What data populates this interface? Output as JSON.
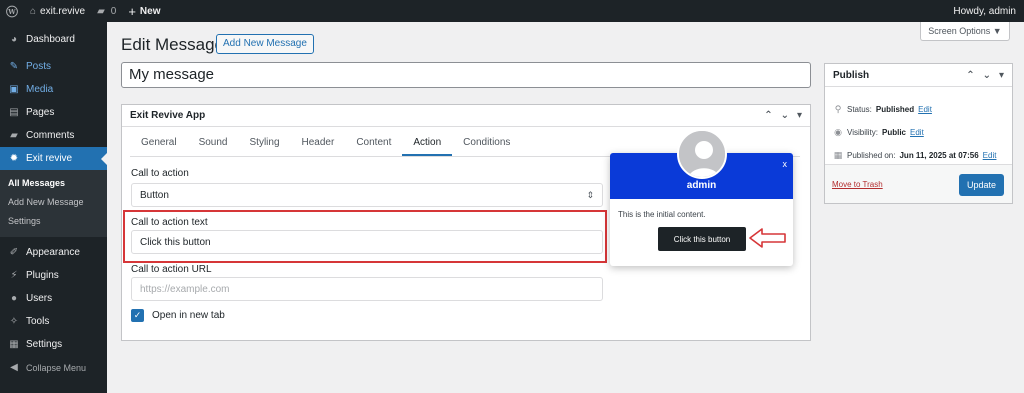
{
  "adminbar": {
    "site_name": "exit.revive",
    "comments_count": "0",
    "new_label": "New",
    "howdy": "Howdy, admin"
  },
  "sidebar": {
    "items": [
      {
        "label": "Dashboard",
        "icon": "dashboard-icon"
      },
      {
        "label": "Posts",
        "icon": "pin-icon"
      },
      {
        "label": "Media",
        "icon": "media-icon"
      },
      {
        "label": "Pages",
        "icon": "pages-icon"
      },
      {
        "label": "Comments",
        "icon": "comments-icon"
      },
      {
        "label": "Exit revive",
        "icon": "gear-icon"
      },
      {
        "label": "Appearance",
        "icon": "brush-icon"
      },
      {
        "label": "Plugins",
        "icon": "plug-icon"
      },
      {
        "label": "Users",
        "icon": "user-icon"
      },
      {
        "label": "Tools",
        "icon": "wrench-icon"
      },
      {
        "label": "Settings",
        "icon": "settings-icon"
      },
      {
        "label": "Collapse Menu",
        "icon": "collapse-icon"
      }
    ],
    "submenu": [
      "All Messages",
      "Add New Message",
      "Settings"
    ]
  },
  "header": {
    "title": "Edit Message",
    "add_new": "Add New Message",
    "screen_options": "Screen Options ▼"
  },
  "post_title": "My message",
  "app_box": {
    "title": "Exit Revive App",
    "tabs": [
      "General",
      "Sound",
      "Styling",
      "Header",
      "Content",
      "Action",
      "Conditions"
    ],
    "active_tab": "Action",
    "cta_label": "Call to action",
    "cta_value": "Button",
    "cta_text_label": "Call to action text",
    "cta_text_value": "Click this button",
    "cta_url_label": "Call to action URL",
    "cta_url_placeholder": "https://example.com",
    "new_tab_label": "Open in new tab"
  },
  "preview": {
    "name": "admin",
    "close": "x",
    "content": "This is the initial content.",
    "button": "Click this button"
  },
  "publish": {
    "title": "Publish",
    "status_label": "Status:",
    "status_value": "Published",
    "visibility_label": "Visibility:",
    "visibility_value": "Public",
    "published_label": "Published on:",
    "published_value": "Jun 11, 2025 at 07:56",
    "edit": "Edit",
    "trash": "Move to Trash",
    "update": "Update"
  },
  "colors": {
    "accent": "#2271b1",
    "preview_header": "#0a3ad8",
    "highlight": "#d63638"
  }
}
